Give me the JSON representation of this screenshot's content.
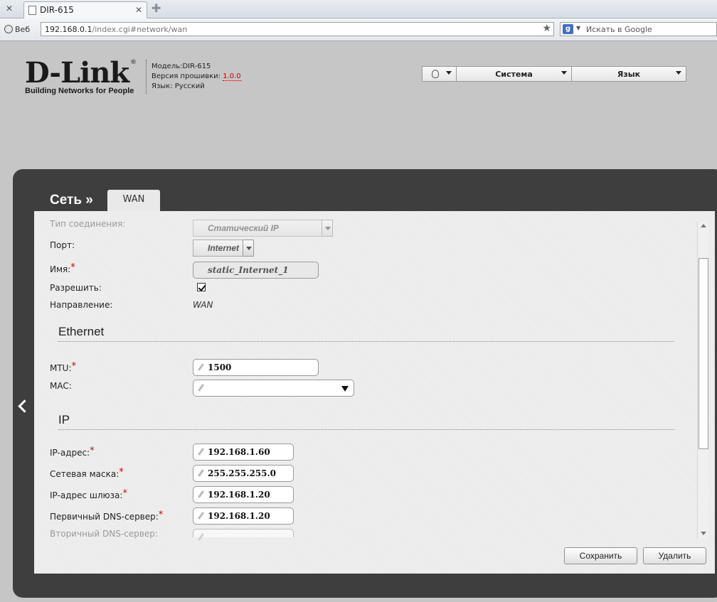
{
  "browser": {
    "tab_title": "DIR-615",
    "web_label": "Веб",
    "url_host": "192.168.0.1",
    "url_path": "/index.cgi#network/wan",
    "search_placeholder": "Искать в Google"
  },
  "header": {
    "logo_text": "D-Link",
    "logo_tagline": "Building Networks for People",
    "model_label": "Модель:",
    "model_value": "DIR-615",
    "firmware_label": "Версия прошивки:",
    "firmware_value": "1.0.0",
    "language_label": "Язык:",
    "language_value": "Русский",
    "menu_system": "Система",
    "menu_language": "Язык"
  },
  "nav": {
    "breadcrumb": "Сеть »",
    "active_tab": "WAN"
  },
  "form": {
    "connection_type_label": "Тип соединения:",
    "connection_type_value": "Статический IP",
    "port_label": "Порт:",
    "port_value": "Internet",
    "name_label": "Имя:",
    "name_value": "static_Internet_1",
    "enable_label": "Разрешить:",
    "enable_checked": true,
    "direction_label": "Направление:",
    "direction_value": "WAN",
    "ethernet_section": "Ethernet",
    "mtu_label": "MTU:",
    "mtu_value": "1500",
    "mac_label": "MAC:",
    "mac_value": "",
    "ip_section": "IP",
    "ip_label": "IP-адрес:",
    "ip_value": "192.168.1.60",
    "mask_label": "Сетевая маска:",
    "mask_value": "255.255.255.0",
    "gateway_label": "IP-адрес шлюза:",
    "gateway_value": "192.168.1.20",
    "dns1_label": "Первичный DNS-сервер:",
    "dns1_value": "192.168.1.20",
    "dns2_label": "Вторичный DNS-сервер:",
    "dns2_value": "",
    "required_mark": "*"
  },
  "actions": {
    "save": "Сохранить",
    "delete": "Удалить"
  }
}
